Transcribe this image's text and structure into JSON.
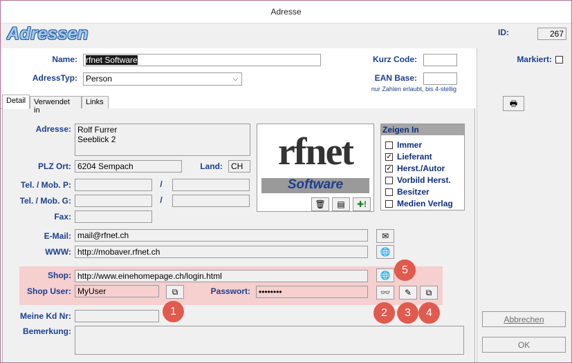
{
  "window": {
    "title": "Adresse"
  },
  "header": {
    "app_title": "Adressen",
    "id_label": "ID:",
    "id_value": "267",
    "markiert_label": "Markiert:"
  },
  "form": {
    "name_label": "Name:",
    "name_value": "rfnet Software",
    "adresstyp_label": "AdressTyp:",
    "adresstyp_value": "Person",
    "kurzcode_label": "Kurz Code:",
    "kurzcode_value": "",
    "ean_label": "EAN Base:",
    "ean_value": "",
    "ean_hint": "nur Zahlen erlaubt, bis 4-stellig"
  },
  "tabs": [
    {
      "label": "Detail"
    },
    {
      "label": "Verwendet in"
    },
    {
      "label": "Links"
    }
  ],
  "detail": {
    "adresse_label": "Adresse:",
    "adresse_line1": "Rolf Furrer",
    "adresse_line2": "Seeblick 2",
    "plz_label": "PLZ Ort:",
    "plz_value": "6204 Sempach",
    "land_label": "Land:",
    "land_value": "CH",
    "telp_label": "Tel. / Mob. P:",
    "telg_label": "Tel. / Mob. G:",
    "slash": "/",
    "fax_label": "Fax:",
    "email_label": "E-Mail:",
    "email_value": "mail@rfnet.ch",
    "www_label": "WWW:",
    "www_value": "http://mobaver.rfnet.ch",
    "shop_label": "Shop:",
    "shop_value": "http://www.einehomepage.ch/login.html",
    "shopuser_label": "Shop User:",
    "shopuser_value": "MyUser",
    "passwort_label": "Passwort:",
    "passwort_value": "••••••••",
    "kdnr_label": "Meine Kd Nr:",
    "kdnr_value": "",
    "bemerkung_label": "Bemerkung:",
    "bemerkung_value": ""
  },
  "logo": {
    "text_top": "rfnet",
    "text_bottom": "Software"
  },
  "zeigen_in": {
    "title": "Zeigen In",
    "items": [
      {
        "label": "Immer",
        "checked": false
      },
      {
        "label": "Lieferant",
        "checked": true
      },
      {
        "label": "Herst./Autor",
        "checked": true
      },
      {
        "label": "Vorbild Herst.",
        "checked": false
      },
      {
        "label": "Besitzer",
        "checked": false
      },
      {
        "label": "Medien Verlag",
        "checked": false
      }
    ]
  },
  "badges": [
    "1",
    "2",
    "3",
    "4",
    "5"
  ],
  "buttons": {
    "abbrechen": "Abbrechen",
    "ok": "OK"
  },
  "colors": {
    "label_blue": "#1b3f8f",
    "highlight_pink": "#f6cfcf",
    "badge_red": "#e05a4e"
  }
}
